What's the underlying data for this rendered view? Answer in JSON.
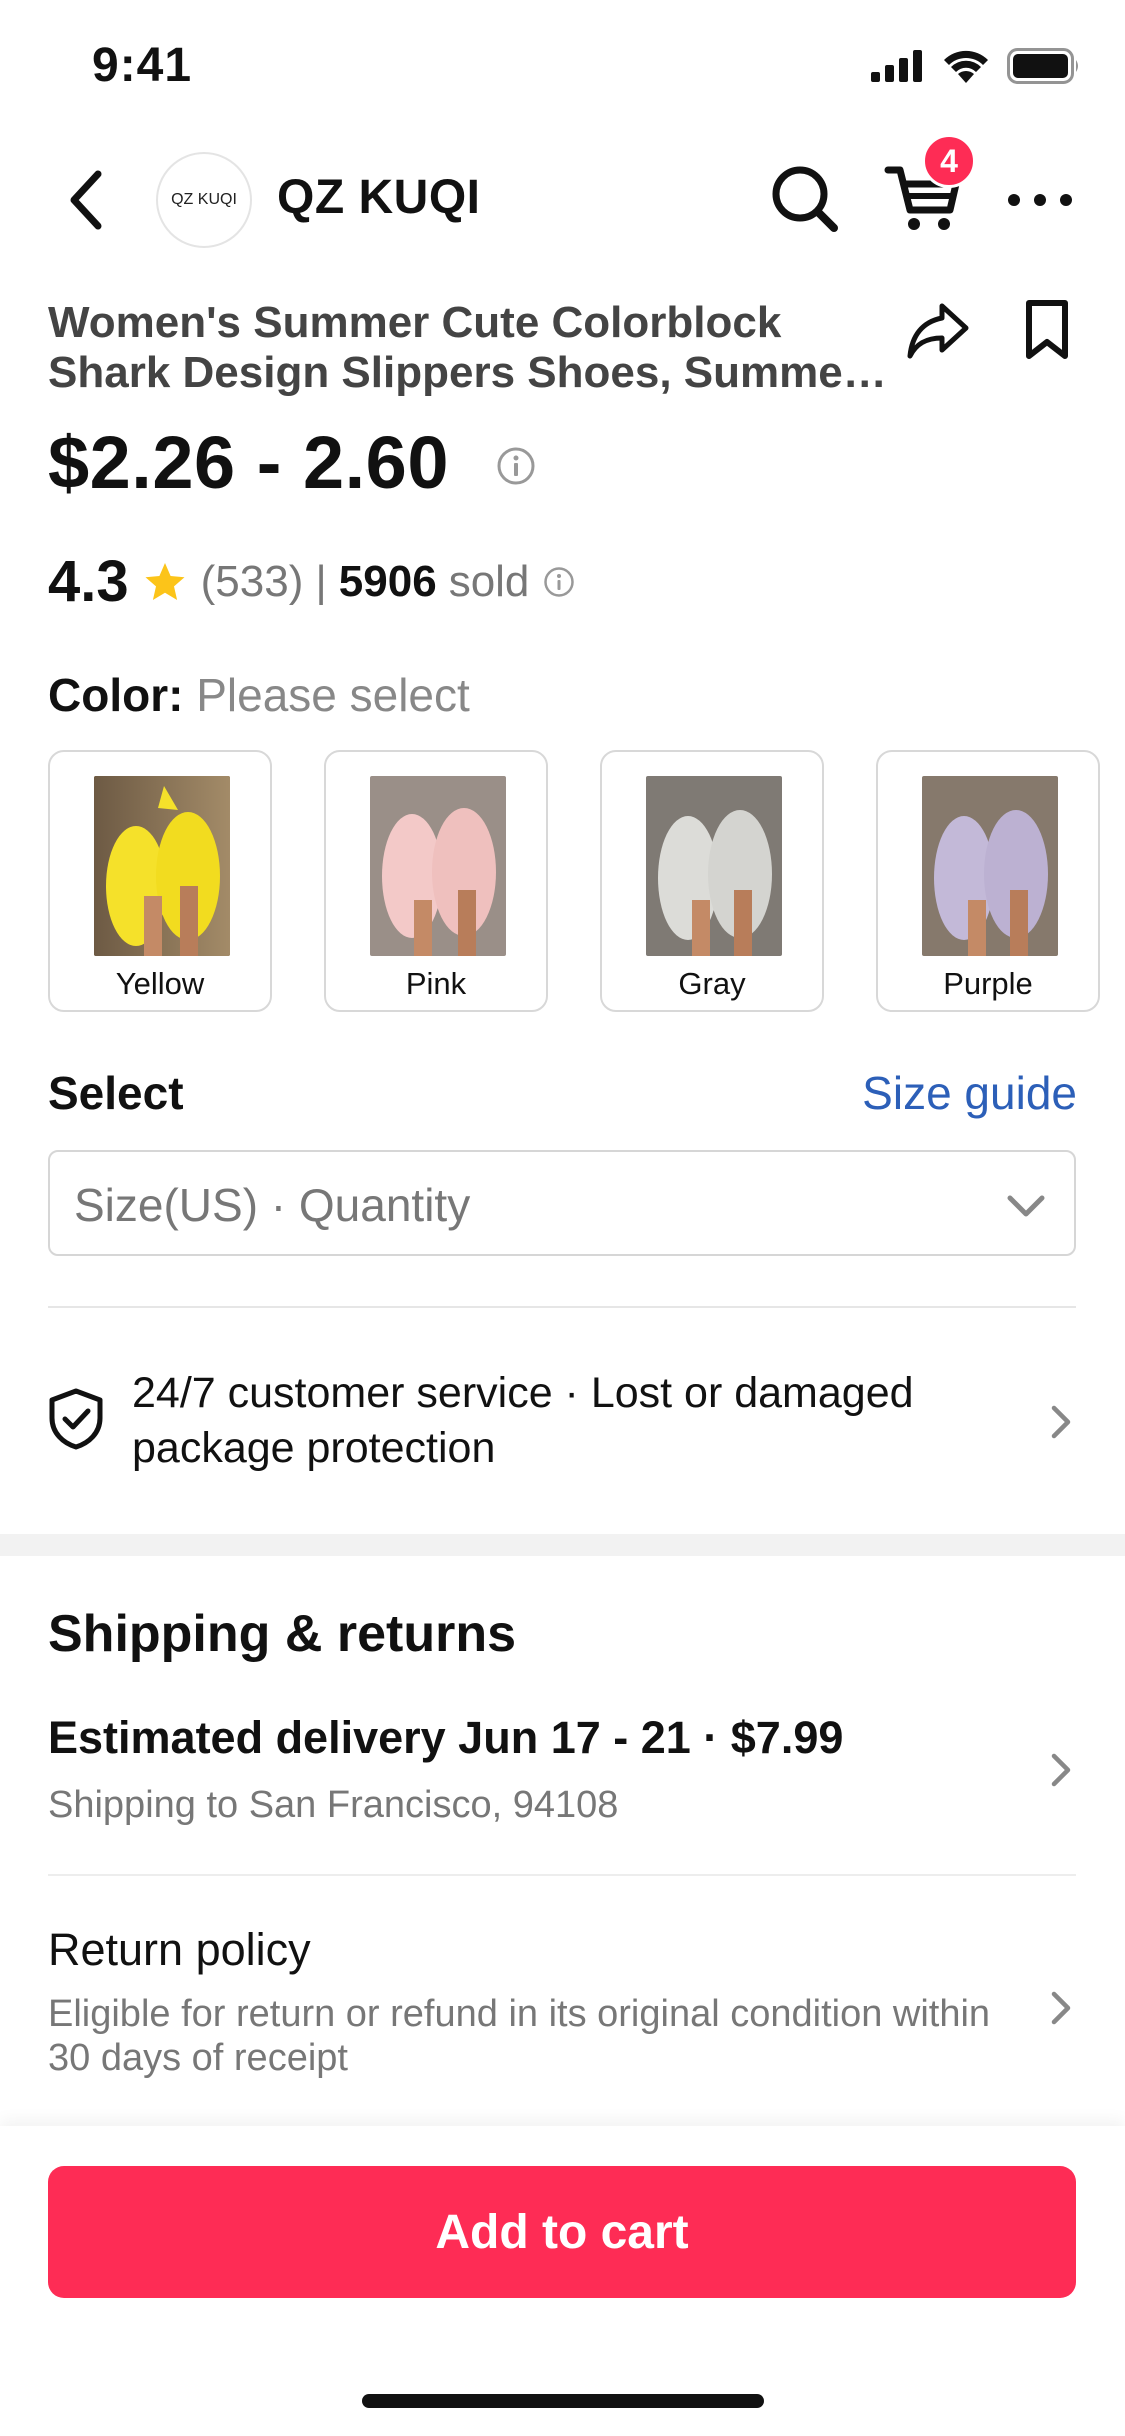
{
  "status_bar": {
    "time": "9:41"
  },
  "nav": {
    "shop_avatar_text": "QZ KUQI",
    "shop_name": "QZ KUQI",
    "cart_count": "4"
  },
  "product": {
    "title_line1": "Women's Summer Cute Colorblock",
    "title_line2": "Shark Design Slippers Shoes, Summer…",
    "price": "$2.26 - 2.60",
    "rating": "4.3",
    "rating_count": "(533)",
    "separator": "|",
    "sold_count": "5906",
    "sold_label": "sold"
  },
  "color": {
    "label": "Color:",
    "value": "Please select",
    "options": [
      {
        "name": "Yellow",
        "color": "#f5e12a"
      },
      {
        "name": "Pink",
        "color": "#f3c9c8"
      },
      {
        "name": "Gray",
        "color": "#d9d9d6"
      },
      {
        "name": "Purple",
        "color": "#c3b9d8"
      }
    ]
  },
  "size": {
    "label": "Select",
    "guide": "Size guide",
    "placeholder": "Size(US) · Quantity"
  },
  "service": {
    "line1": "24/7 customer service · Lost or damaged",
    "line2": "package protection"
  },
  "shipping": {
    "title": "Shipping & returns",
    "delivery": "Estimated delivery Jun 17 - 21 · $7.99",
    "delivery_sub": "Shipping to San Francisco, 94108",
    "returns_title": "Return policy",
    "returns_sub": "Eligible for return or refund in its original condition within 30 days of receipt"
  },
  "cta": {
    "add_to_cart": "Add to cart"
  },
  "colors": {
    "accent": "#fe2c55",
    "link": "#2c5fb8"
  }
}
